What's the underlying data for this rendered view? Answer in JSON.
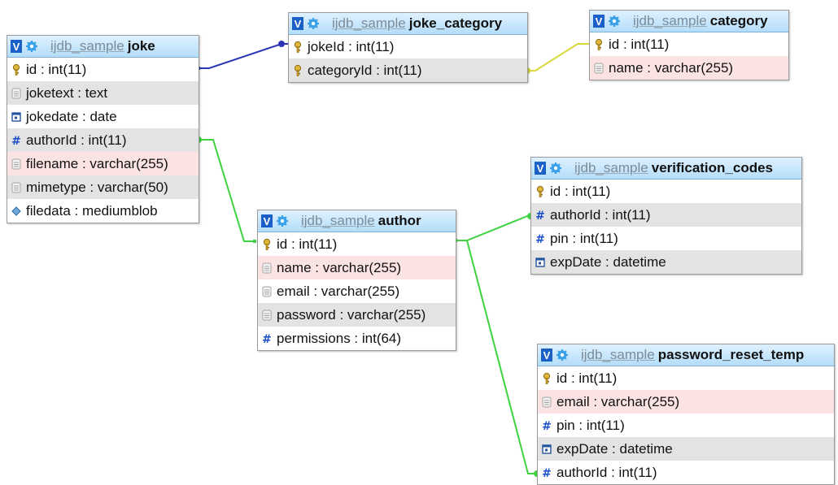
{
  "tables": {
    "joke": {
      "schema": "ijdb_sample",
      "name": "joke",
      "columns": [
        {
          "text": "id : int(11)",
          "icon": "key-icon",
          "shade": "none"
        },
        {
          "text": "joketext : text",
          "icon": "text-field-icon",
          "shade": "gray"
        },
        {
          "text": "jokedate : date",
          "icon": "date-field-icon",
          "shade": "none"
        },
        {
          "text": "authorId : int(11)",
          "icon": "number-field-icon",
          "shade": "gray"
        },
        {
          "text": "filename : varchar(255)",
          "icon": "text-field-icon",
          "shade": "pink"
        },
        {
          "text": "mimetype : varchar(50)",
          "icon": "text-field-icon",
          "shade": "gray"
        },
        {
          "text": "filedata : mediumblob",
          "icon": "blob-field-icon",
          "shade": "none"
        }
      ]
    },
    "joke_category": {
      "schema": "ijdb_sample",
      "name": "joke_category",
      "columns": [
        {
          "text": "jokeId : int(11)",
          "icon": "key-icon",
          "shade": "none"
        },
        {
          "text": "categoryId : int(11)",
          "icon": "key-icon",
          "shade": "gray"
        }
      ]
    },
    "category": {
      "schema": "ijdb_sample",
      "name": "category",
      "columns": [
        {
          "text": "id : int(11)",
          "icon": "key-icon",
          "shade": "none"
        },
        {
          "text": "name : varchar(255)",
          "icon": "text-field-icon",
          "shade": "pink"
        }
      ]
    },
    "author": {
      "schema": "ijdb_sample",
      "name": "author",
      "columns": [
        {
          "text": "id : int(11)",
          "icon": "key-icon",
          "shade": "none"
        },
        {
          "text": "name : varchar(255)",
          "icon": "text-field-icon",
          "shade": "pink"
        },
        {
          "text": "email : varchar(255)",
          "icon": "text-field-icon",
          "shade": "none"
        },
        {
          "text": "password : varchar(255)",
          "icon": "text-field-icon",
          "shade": "gray"
        },
        {
          "text": "permissions : int(64)",
          "icon": "number-field-icon",
          "shade": "none"
        }
      ]
    },
    "verification_codes": {
      "schema": "ijdb_sample",
      "name": "verification_codes",
      "columns": [
        {
          "text": "id : int(11)",
          "icon": "key-icon",
          "shade": "none"
        },
        {
          "text": "authorId : int(11)",
          "icon": "number-field-icon",
          "shade": "gray"
        },
        {
          "text": "pin : int(11)",
          "icon": "number-field-icon",
          "shade": "none"
        },
        {
          "text": "expDate : datetime",
          "icon": "date-field-icon",
          "shade": "gray"
        }
      ]
    },
    "password_reset_temp": {
      "schema": "ijdb_sample",
      "name": "password_reset_temp",
      "columns": [
        {
          "text": "id : int(11)",
          "icon": "key-icon",
          "shade": "none"
        },
        {
          "text": "email : varchar(255)",
          "icon": "text-field-icon",
          "shade": "pink"
        },
        {
          "text": "pin : int(11)",
          "icon": "number-field-icon",
          "shade": "none"
        },
        {
          "text": "expDate : datetime",
          "icon": "date-field-icon",
          "shade": "gray"
        },
        {
          "text": "authorId : int(11)",
          "icon": "number-field-icon",
          "shade": "none"
        }
      ]
    }
  },
  "relations": [
    {
      "from": "joke.id",
      "to": "joke_category.jokeId",
      "color": "#2c35b5"
    },
    {
      "from": "category.id",
      "to": "joke_category.categoryId",
      "color": "#d9d83a"
    },
    {
      "from": "author.id",
      "to": "joke.authorId",
      "color": "#3fd23f"
    },
    {
      "from": "author.id",
      "to": "verification_codes.authorId",
      "color": "#3fd23f"
    },
    {
      "from": "author.id",
      "to": "password_reset_temp.authorId",
      "color": "#3fd23f"
    }
  ],
  "colors": {
    "header_gradient_top": "#dff1ff",
    "header_gradient_bottom": "#b4ddf9",
    "row_gray": "#e3e3e3",
    "row_pink": "#fbe3e3",
    "v_button": "#1b5fc9"
  }
}
